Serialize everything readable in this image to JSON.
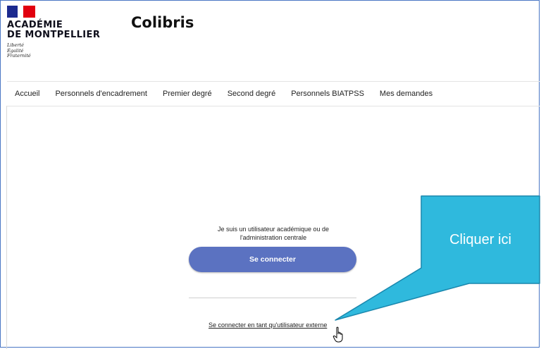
{
  "header": {
    "logo": {
      "line1": "ACADÉMIE",
      "line2": "DE MONTPELLIER",
      "motto": [
        "Liberté",
        "Égalité",
        "Fraternité"
      ]
    },
    "app_title": "Colibris"
  },
  "nav": {
    "items": [
      {
        "label": "Accueil"
      },
      {
        "label": "Personnels d'encadrement"
      },
      {
        "label": "Premier degré"
      },
      {
        "label": "Second degré"
      },
      {
        "label": "Personnels BIATPSS"
      },
      {
        "label": "Mes demandes"
      }
    ]
  },
  "main": {
    "intro_text": "Je suis un utilisateur académique ou de l'administration centrale",
    "connect_button": "Se connecter",
    "external_link": "Se connecter en tant qu'utilisateur externe"
  },
  "callout": {
    "text": "Cliquer ici",
    "color": "#2fb9dd",
    "border_color": "#1a87ad"
  },
  "icons": {
    "cursor": "hand-pointer-icon"
  },
  "colors": {
    "button_bg": "#5b72c1",
    "frame_border": "#4a77c4"
  }
}
